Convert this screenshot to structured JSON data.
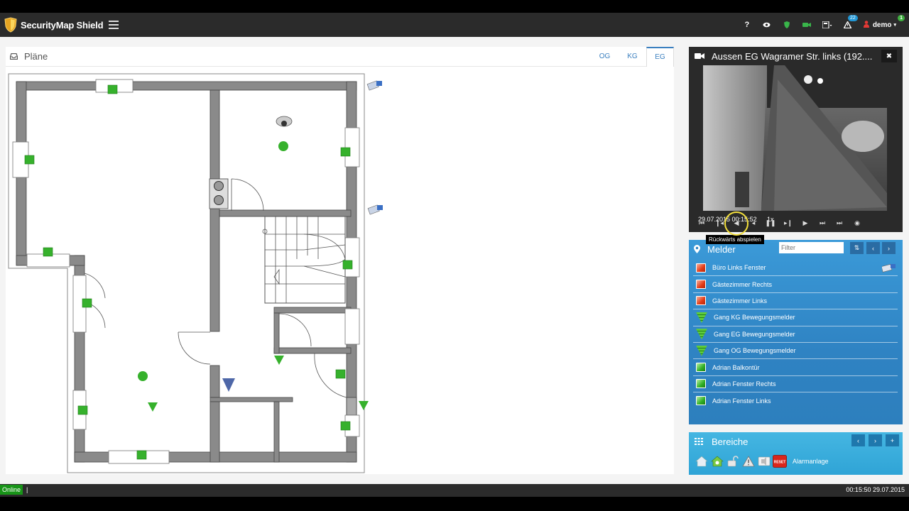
{
  "app": {
    "title": "SecurityMap Shield"
  },
  "nav": {
    "help_icon": "?",
    "notification_count": "22",
    "user_name": "demo",
    "user_badge": "1"
  },
  "plans": {
    "title": "Pläne",
    "tabs": [
      {
        "label": "OG",
        "active": false
      },
      {
        "label": "KG",
        "active": false
      },
      {
        "label": "EG",
        "active": true
      }
    ]
  },
  "video": {
    "title": "Aussen EG Wagramer Str. links (192....",
    "timestamp": "29.07.2015 00:15:52",
    "speed": "1x",
    "tooltip": "Rückwärts abspielen"
  },
  "melder": {
    "title": "Melder",
    "filter_placeholder": "Filter",
    "items": [
      {
        "label": "Büro Links Fenster",
        "type": "window-alarm",
        "camera": true
      },
      {
        "label": "Gästezimmer Rechts",
        "type": "window-alarm"
      },
      {
        "label": "Gästezimmer Links",
        "type": "window-alarm"
      },
      {
        "label": "Gang KG Bewegungsmelder",
        "type": "motion"
      },
      {
        "label": "Gang EG Bewegungsmelder",
        "type": "motion"
      },
      {
        "label": "Gang OG Bewegungsmelder",
        "type": "motion"
      },
      {
        "label": "Adrian Balkontür",
        "type": "window-ok"
      },
      {
        "label": "Adrian Fenster Rechts",
        "type": "window-ok"
      },
      {
        "label": "Adrian Fenster Links",
        "type": "window-ok"
      }
    ]
  },
  "bereiche": {
    "title": "Bereiche",
    "area_label": "Alarmanlage",
    "reset_label": "RESET"
  },
  "status": {
    "online": "Online",
    "separator": "|",
    "clock": "00:15:50 29.07.2015"
  },
  "colors": {
    "accent": "#3a7fbf",
    "melder_bg": "#2f83c3",
    "bereiche_bg": "#38acdc",
    "online": "#189418",
    "alarm_red": "#e33b16",
    "ok_green": "#31b025"
  }
}
